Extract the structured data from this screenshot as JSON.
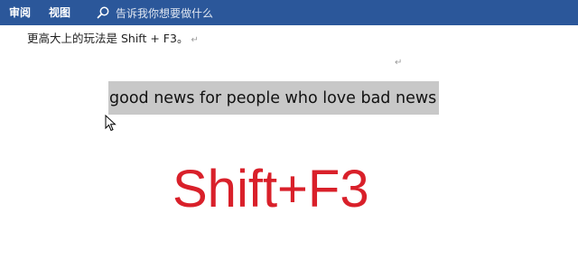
{
  "ribbon": {
    "tabs": [
      "审阅",
      "视图"
    ],
    "tellme_placeholder": "告诉我你想要做什么",
    "background_color": "#2b579a",
    "search_icon": "search-icon"
  },
  "document": {
    "line1": "更高大上的玩法是 Shift + F3。",
    "paragraph_mark": "↵",
    "selected_text": "good news for people who love bad news",
    "selection_color": "#c8c8c8"
  },
  "overlay": {
    "shortcut_text": "Shift+F3",
    "color": "#d9202a"
  }
}
